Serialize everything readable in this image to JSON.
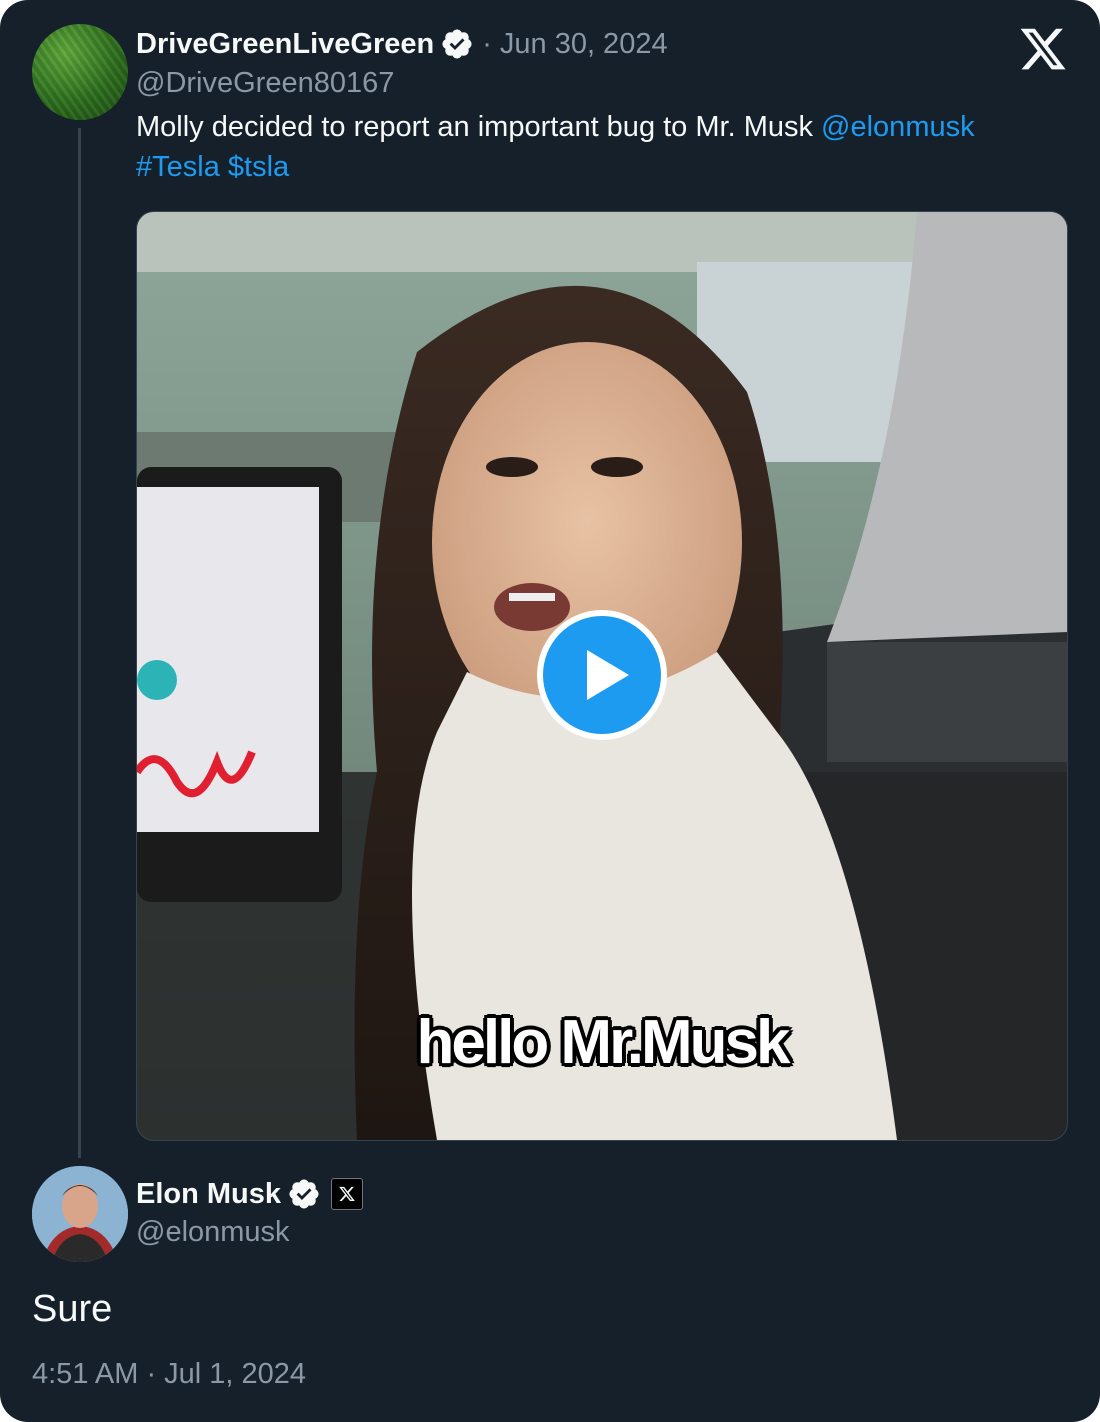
{
  "original_tweet": {
    "display_name": "DriveGreenLiveGreen",
    "separator": "·",
    "date": "Jun 30, 2024",
    "handle": "@DriveGreen80167",
    "text_plain": "Molly decided to report an important bug to Mr. Musk ",
    "mention": "@elonmusk",
    "hashtag": "#Tesla",
    "cashtag": "$tsla",
    "video_caption": "hello Mr.Musk"
  },
  "reply": {
    "display_name": "Elon Musk",
    "handle": "@elonmusk",
    "text": "Sure",
    "timestamp": "4:51 AM · Jul 1, 2024"
  },
  "icons": {
    "verified": "verified-badge-icon",
    "brand": "x-logo-icon",
    "play": "play-icon",
    "affiliate": "x-affiliation-badge-icon"
  },
  "colors": {
    "background": "#15202b",
    "link": "#1d9bf0",
    "muted": "#8b98a5",
    "text": "#f7f9f9",
    "play_button": "#1d9bf0"
  }
}
